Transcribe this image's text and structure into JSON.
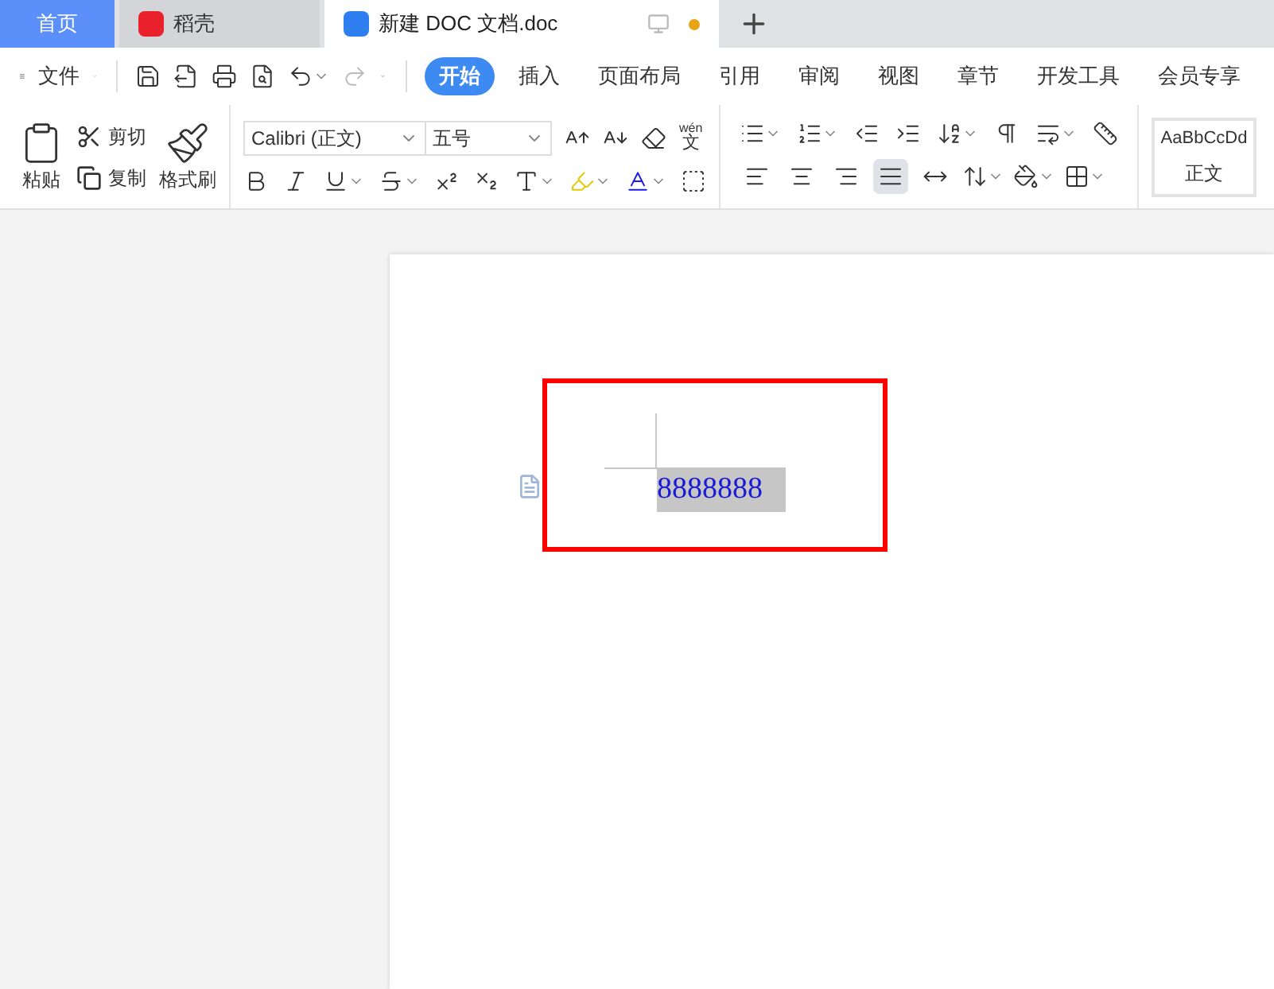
{
  "tabs": [
    {
      "label": "首页",
      "kind": "home",
      "selected": false
    },
    {
      "label": "稻壳",
      "kind": "store",
      "selected": false
    },
    {
      "label": "新建 DOC 文档.doc",
      "kind": "doc",
      "selected": true,
      "unsaved": true
    }
  ],
  "menu": {
    "file_label": "文件",
    "ribbon_tabs": [
      {
        "label": "开始",
        "selected": true
      },
      {
        "label": "插入",
        "selected": false
      },
      {
        "label": "页面布局",
        "selected": false
      },
      {
        "label": "引用",
        "selected": false
      },
      {
        "label": "审阅",
        "selected": false
      },
      {
        "label": "视图",
        "selected": false
      },
      {
        "label": "章节",
        "selected": false
      },
      {
        "label": "开发工具",
        "selected": false
      },
      {
        "label": "会员专享",
        "selected": false
      }
    ]
  },
  "clipboard": {
    "paste": "粘贴",
    "cut": "剪切",
    "copy": "复制",
    "format_painter": "格式刷"
  },
  "font": {
    "name": "Calibri (正文)",
    "size": "五号",
    "pinyin_top": "wén",
    "pinyin_bottom": "文"
  },
  "alignments": [
    {
      "kind": "left",
      "selected": false
    },
    {
      "kind": "center",
      "selected": false
    },
    {
      "kind": "right",
      "selected": false
    },
    {
      "kind": "justify",
      "selected": true
    },
    {
      "kind": "distribute",
      "selected": false
    }
  ],
  "style": {
    "sample": "AaBbCcDd",
    "name": "正文"
  },
  "document": {
    "text": "8888888",
    "text_selected": true,
    "annotation_box": true
  }
}
